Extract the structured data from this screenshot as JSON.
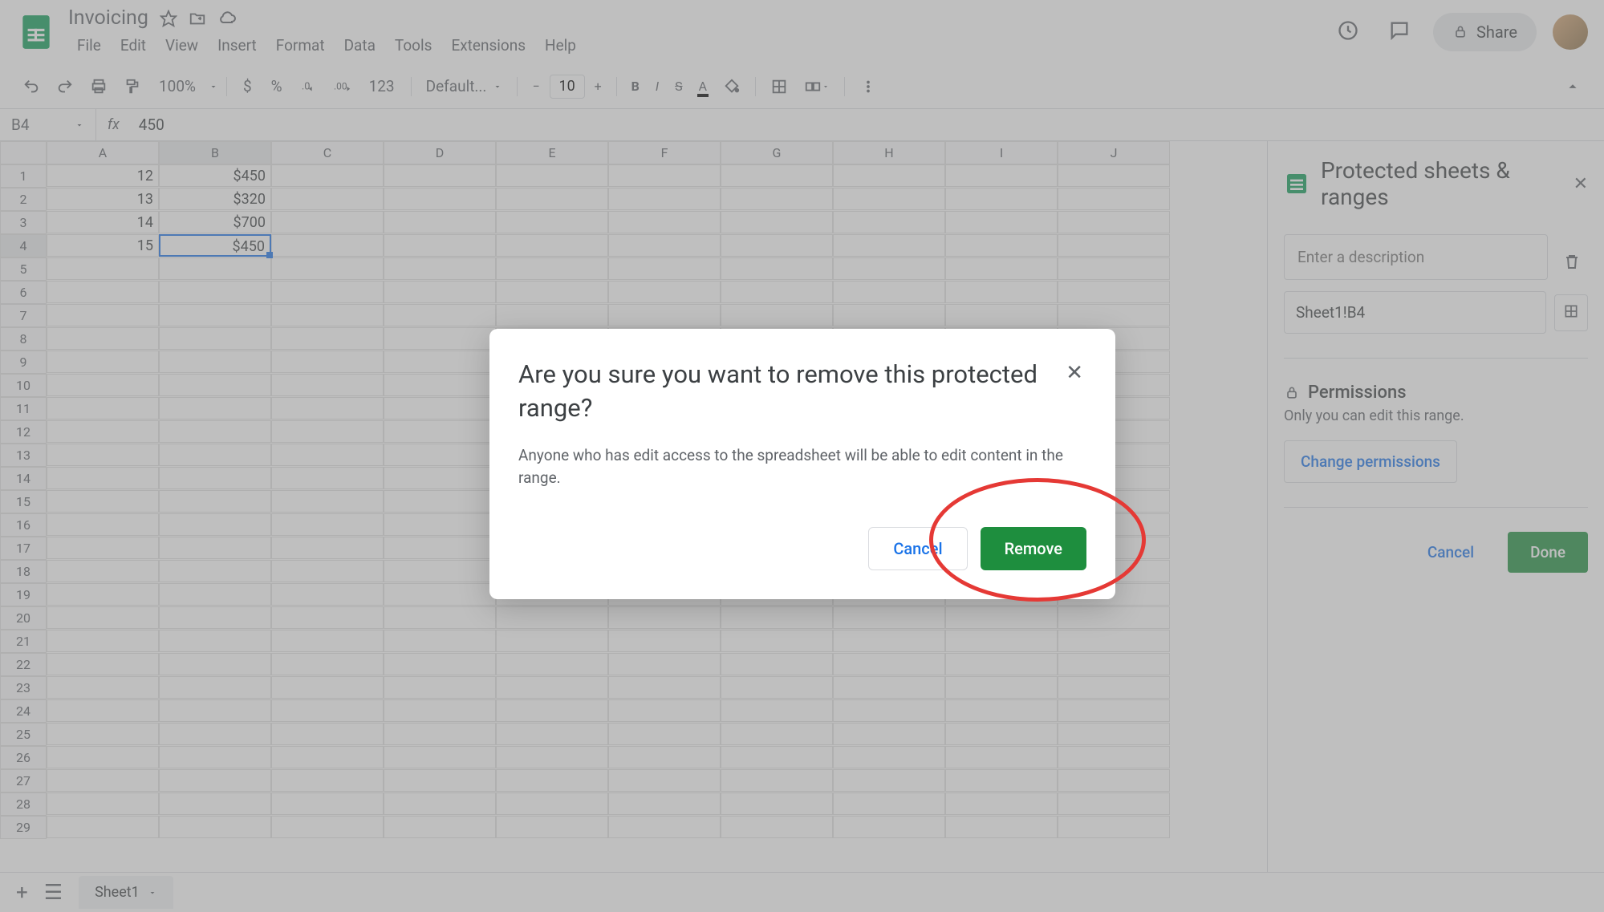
{
  "doc": {
    "title": "Invoicing"
  },
  "menus": [
    "File",
    "Edit",
    "View",
    "Insert",
    "Format",
    "Data",
    "Tools",
    "Extensions",
    "Help"
  ],
  "toolbar": {
    "zoom": "100%",
    "format123": "123",
    "font_name": "Default...",
    "font_size": "10"
  },
  "header": {
    "share": "Share"
  },
  "formula": {
    "cell": "B4",
    "value": "450"
  },
  "columns": [
    "A",
    "B",
    "C",
    "D",
    "E",
    "F",
    "G",
    "H",
    "I",
    "J"
  ],
  "rows": [
    1,
    2,
    3,
    4,
    5,
    6,
    7,
    8,
    9,
    10,
    11,
    12,
    13,
    14,
    15,
    16,
    17,
    18,
    19,
    20,
    21,
    22,
    23,
    24,
    25,
    26,
    27,
    28,
    29
  ],
  "cells": {
    "r1": {
      "A": "12",
      "B": "$450"
    },
    "r2": {
      "A": "13",
      "B": "$320"
    },
    "r3": {
      "A": "14",
      "B": "$700"
    },
    "r4": {
      "A": "15",
      "B": "$450"
    }
  },
  "sidebar": {
    "title": "Protected sheets & ranges",
    "desc_placeholder": "Enter a description",
    "range": "Sheet1!B4",
    "permissions_title": "Permissions",
    "permissions_desc": "Only you can edit this range.",
    "change_perm": "Change permissions",
    "cancel": "Cancel",
    "done": "Done"
  },
  "tabs": {
    "sheet1": "Sheet1"
  },
  "modal": {
    "title": "Are you sure you want to remove this protected range?",
    "body": "Anyone who has edit access to the spreadsheet will be able to edit content in the range.",
    "cancel": "Cancel",
    "remove": "Remove"
  }
}
